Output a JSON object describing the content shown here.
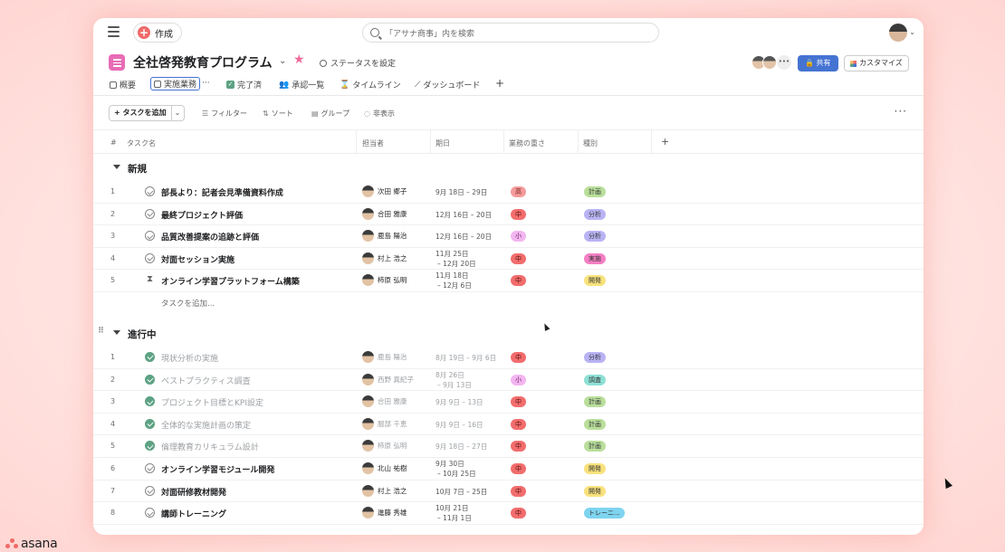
{
  "topbar": {
    "create_label": "作成",
    "search_placeholder": "「アサナ商事」内を検索"
  },
  "project": {
    "title": "全社啓発教育プログラム",
    "status_label": "ステータスを設定",
    "share_label": "共有",
    "customize_label": "カスタマイズ"
  },
  "tabs": [
    {
      "label": "概要"
    },
    {
      "label": "実施業務"
    },
    {
      "label": "完了済"
    },
    {
      "label": "承認一覧"
    },
    {
      "label": "タイムライン"
    },
    {
      "label": "ダッシュボード"
    }
  ],
  "toolbar": {
    "add_task": "タスクを追加",
    "filter": "フィルター",
    "sort": "ソート",
    "group": "グループ",
    "hide": "非表示"
  },
  "columns": {
    "num": "#",
    "task": "タスク名",
    "assignee": "担当者",
    "due": "期日",
    "weight": "業務の重さ",
    "type": "種別"
  },
  "colors": {
    "weight_high": "#f59b9b",
    "weight_mid": "#f26d6d",
    "weight_low": "#f3b6f0",
    "type_plan": "#b9df9b",
    "type_analysis": "#b9b3f4",
    "type_execute": "#f47fc4",
    "type_develop": "#f8e27c",
    "type_survey": "#8ee0d6",
    "type_training": "#7fd4ef"
  },
  "sections": [
    {
      "title": "新規",
      "add_label": "タスクを追加...",
      "rows": [
        {
          "num": "1",
          "name": "部長より：記者会見準備資料作成",
          "assignee": "次田 郷子",
          "date1": "9月 18日 – 29日",
          "date2": "",
          "weight": "高",
          "type": "計画"
        },
        {
          "num": "2",
          "name": "最終プロジェクト評価",
          "assignee": "合田 雅康",
          "date1": "12月 16日 – 20日",
          "date2": "",
          "weight": "中",
          "type": "分析"
        },
        {
          "num": "3",
          "name": "品質改善提案の追跡と評価",
          "assignee": "鹿島 陽治",
          "date1": "12月 16日 – 20日",
          "date2": "",
          "weight": "小",
          "type": "分析"
        },
        {
          "num": "4",
          "name": "対面セッション実施",
          "assignee": "村上 浩之",
          "date1": "11月 25日",
          "date2": "– 12月 20日",
          "weight": "中",
          "type": "実施"
        },
        {
          "num": "5",
          "name": "オンライン学習プラットフォーム構築",
          "assignee": "柿原 弘明",
          "date1": "11月 18日",
          "date2": "– 12月 6日",
          "weight": "中",
          "type": "開発"
        }
      ]
    },
    {
      "title": "進行中",
      "rows": [
        {
          "num": "1",
          "name": "現状分析の実施",
          "assignee": "鹿島 陽治",
          "date1": "8月 19日 – 9月 6日",
          "date2": "",
          "weight": "中",
          "type": "分析"
        },
        {
          "num": "2",
          "name": "ベストプラクティス調査",
          "assignee": "西野 真紀子",
          "date1": "8月 26日",
          "date2": "– 9月 13日",
          "weight": "小",
          "type": "調査"
        },
        {
          "num": "3",
          "name": "プロジェクト目標とKPI設定",
          "assignee": "合田 雅康",
          "date1": "9月 9日 – 13日",
          "date2": "",
          "weight": "中",
          "type": "計画"
        },
        {
          "num": "4",
          "name": "全体的な実施計画の策定",
          "assignee": "服部 千恵",
          "date1": "9月 9日 – 16日",
          "date2": "",
          "weight": "中",
          "type": "計画"
        },
        {
          "num": "5",
          "name": "倫理教育カリキュラム設計",
          "assignee": "柿原 弘明",
          "date1": "9月 18日 – 27日",
          "date2": "",
          "weight": "中",
          "type": "計画"
        },
        {
          "num": "6",
          "name": "オンライン学習モジュール開発",
          "assignee": "北山 祐樹",
          "date1": "9月 30日",
          "date2": "– 10月 25日",
          "weight": "中",
          "type": "開発"
        },
        {
          "num": "7",
          "name": "対面研修教材開発",
          "assignee": "村上 浩之",
          "date1": "10月 7日 – 25日",
          "date2": "",
          "weight": "中",
          "type": "開発"
        },
        {
          "num": "8",
          "name": "講師トレーニング",
          "assignee": "進藤 秀雄",
          "date1": "10月 21日",
          "date2": "– 11月 1日",
          "weight": "中",
          "type": "トレーニ..."
        }
      ]
    }
  ],
  "brand": {
    "name": "asana"
  }
}
